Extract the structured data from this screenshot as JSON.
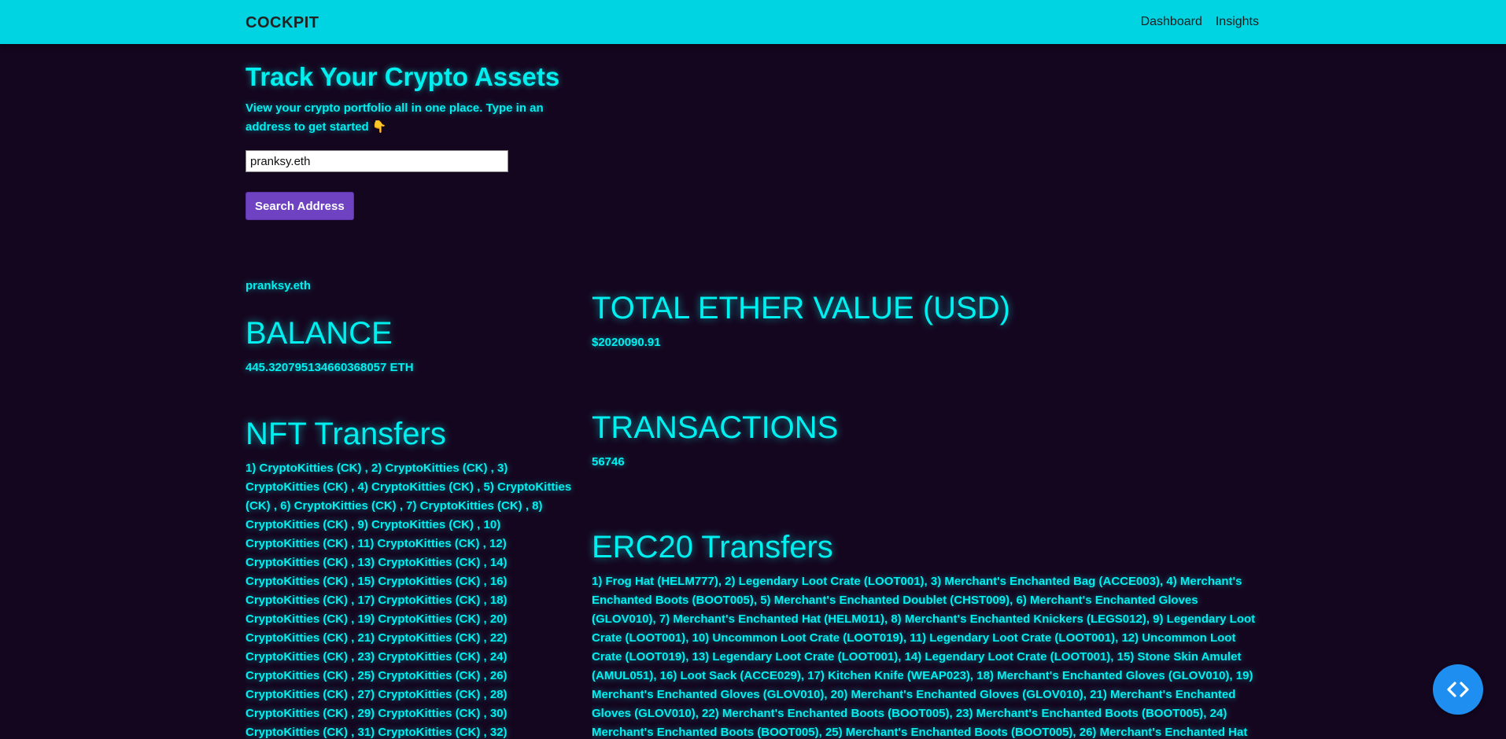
{
  "navbar": {
    "brand": "COCKPIT",
    "links": [
      "Dashboard",
      "Insights"
    ]
  },
  "hero": {
    "title": "Track Your Crypto Assets",
    "subtitle": "View your crypto portfolio all in one place. Type in an address to get started",
    "subtitle_emoji": "👇"
  },
  "search": {
    "value": "pranksy.eth",
    "button_label": "Search Address"
  },
  "result": {
    "address": "pranksy.eth",
    "balance_title": "BALANCE",
    "balance_value": "445.320795134660368057 ETH",
    "total_title": "TOTAL ETHER VALUE (USD)",
    "total_value": "$2020090.91",
    "transactions_title": "TRANSACTIONS",
    "transactions_value": "56746",
    "nft_title": "NFT Transfers",
    "nft_text": "1) CryptoKitties (CK) , 2) CryptoKitties (CK) , 3) CryptoKitties (CK) , 4) CryptoKitties (CK) , 5) CryptoKitties (CK) , 6) CryptoKitties (CK) , 7) CryptoKitties (CK) , 8) CryptoKitties (CK) , 9) CryptoKitties (CK) , 10) CryptoKitties (CK) , 11) CryptoKitties (CK) , 12) CryptoKitties (CK) , 13) CryptoKitties (CK) , 14) CryptoKitties (CK) , 15) CryptoKitties (CK) , 16) CryptoKitties (CK) , 17) CryptoKitties (CK) , 18) CryptoKitties (CK) , 19) CryptoKitties (CK) , 20) CryptoKitties (CK) , 21) CryptoKitties (CK) , 22) CryptoKitties (CK) , 23) CryptoKitties (CK) , 24) CryptoKitties (CK) , 25) CryptoKitties (CK) , 26) CryptoKitties (CK) , 27) CryptoKitties (CK) , 28) CryptoKitties (CK) , 29) CryptoKitties (CK) , 30) CryptoKitties (CK) , 31) CryptoKitties (CK) , 32)",
    "erc20_title": "ERC20 Transfers",
    "erc20_text": "1) Frog Hat (HELM777), 2) Legendary Loot Crate (LOOT001), 3) Merchant's Enchanted Bag (ACCE003), 4) Merchant's Enchanted Boots (BOOT005), 5) Merchant's Enchanted Doublet (CHST009), 6) Merchant's Enchanted Gloves (GLOV010), 7) Merchant's Enchanted Hat (HELM011), 8) Merchant's Enchanted Knickers (LEGS012), 9) Legendary Loot Crate (LOOT001), 10) Uncommon Loot Crate (LOOT019), 11) Legendary Loot Crate (LOOT001), 12) Uncommon Loot Crate (LOOT019), 13) Legendary Loot Crate (LOOT001), 14) Legendary Loot Crate (LOOT001), 15) Stone Skin Amulet (AMUL051), 16) Loot Sack (ACCE029), 17) Kitchen Knife (WEAP023), 18) Merchant's Enchanted Gloves (GLOV010), 19) Merchant's Enchanted Gloves (GLOV010), 20) Merchant's Enchanted Gloves (GLOV010), 21) Merchant's Enchanted Gloves (GLOV010), 22) Merchant's Enchanted Boots (BOOT005), 23) Merchant's Enchanted Boots (BOOT005), 24) Merchant's Enchanted Boots (BOOT005), 25) Merchant's Enchanted Boots (BOOT005), 26) Merchant's Enchanted Hat"
  },
  "colors": {
    "navbar": "#00d4e3",
    "background": "#15061f",
    "accent_text": "#00f0f0",
    "button": "#6f42c1",
    "fab": "#1e8ff0"
  },
  "icons": {
    "fab": "code-icon",
    "subtitle_emoji": "pointing-down-icon"
  }
}
